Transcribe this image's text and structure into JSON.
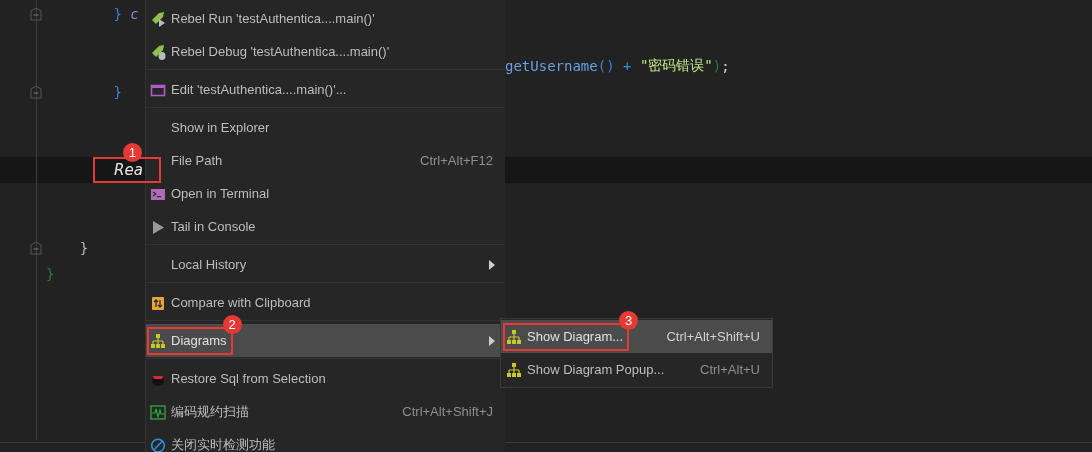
{
  "editor": {
    "lines": [
      {
        "current": false,
        "fold": true,
        "tokens": [
          {
            "text": "        }",
            "kind": "bracket"
          },
          {
            "text": " c",
            "kind": "keyword"
          }
        ]
      },
      {
        "current": false,
        "fold": false
      },
      {
        "current": false,
        "fold": false,
        "tokens_after_menu": [
          {
            "text": "getUsername",
            "kind": "method"
          },
          {
            "text": "()",
            "kind": "bracket"
          },
          {
            "text": " + ",
            "kind": "operator"
          },
          {
            "text": "\"密码错误\"",
            "kind": "string"
          },
          {
            "text": ")",
            "kind": "outer"
          },
          {
            "text": ";",
            "kind": "punctuation"
          }
        ]
      },
      {
        "current": false,
        "fold": true,
        "tokens": [
          {
            "text": "        }",
            "kind": "bracket"
          }
        ]
      },
      {
        "current": false,
        "fold": false
      },
      {
        "current": false,
        "fold": false
      },
      {
        "current": true,
        "fold": false,
        "tokens": [
          {
            "text": "Rea",
            "kind": "italic",
            "annotation": "1"
          }
        ]
      },
      {
        "current": false,
        "fold": false
      },
      {
        "current": false,
        "fold": false
      },
      {
        "current": false,
        "fold": true,
        "tokens": [
          {
            "text": "    }",
            "kind": "plain"
          }
        ]
      },
      {
        "current": false,
        "fold": false,
        "tokens": [
          {
            "text": "}",
            "kind": "outer"
          }
        ]
      }
    ]
  },
  "context_menu": {
    "items": [
      {
        "kind": "item",
        "label": "Rebel Run 'testAuthentica....main()'",
        "selected": false
      },
      {
        "kind": "item",
        "label": "Rebel Debug 'testAuthentica....main()'",
        "selected": false
      },
      {
        "kind": "separator"
      },
      {
        "kind": "item",
        "label": "Edit 'testAuthentica....main()'...",
        "selected": false
      },
      {
        "kind": "separator"
      },
      {
        "kind": "item",
        "label": "Show in Explorer",
        "selected": false
      },
      {
        "kind": "item",
        "label": "File Path",
        "shortcut": "Ctrl+Alt+F12",
        "selected": false
      },
      {
        "kind": "item",
        "label": "Open in Terminal",
        "selected": false
      },
      {
        "kind": "item",
        "label": "Tail in Console",
        "selected": false
      },
      {
        "kind": "separator"
      },
      {
        "kind": "item",
        "label": "Local History",
        "submenu": true,
        "selected": false
      },
      {
        "kind": "separator"
      },
      {
        "kind": "item",
        "label": "Compare with Clipboard",
        "selected": false
      },
      {
        "kind": "separator"
      },
      {
        "kind": "item",
        "label": "Diagrams",
        "submenu": true,
        "selected": true,
        "annotation": "2"
      },
      {
        "kind": "separator"
      },
      {
        "kind": "item",
        "label": "Restore Sql from Selection",
        "selected": false
      },
      {
        "kind": "item",
        "label": "编码规约扫描",
        "shortcut": "Ctrl+Alt+Shift+J",
        "selected": false
      },
      {
        "kind": "item",
        "label": "关闭实时检测功能",
        "selected": false
      }
    ]
  },
  "submenu": {
    "items": [
      {
        "kind": "item",
        "label": "Show Diagram...",
        "shortcut": "Ctrl+Alt+Shift+U",
        "selected": true,
        "annotation": "3"
      },
      {
        "kind": "item",
        "label": "Show Diagram Popup...",
        "shortcut": "Ctrl+Alt+U",
        "selected": false
      }
    ]
  }
}
